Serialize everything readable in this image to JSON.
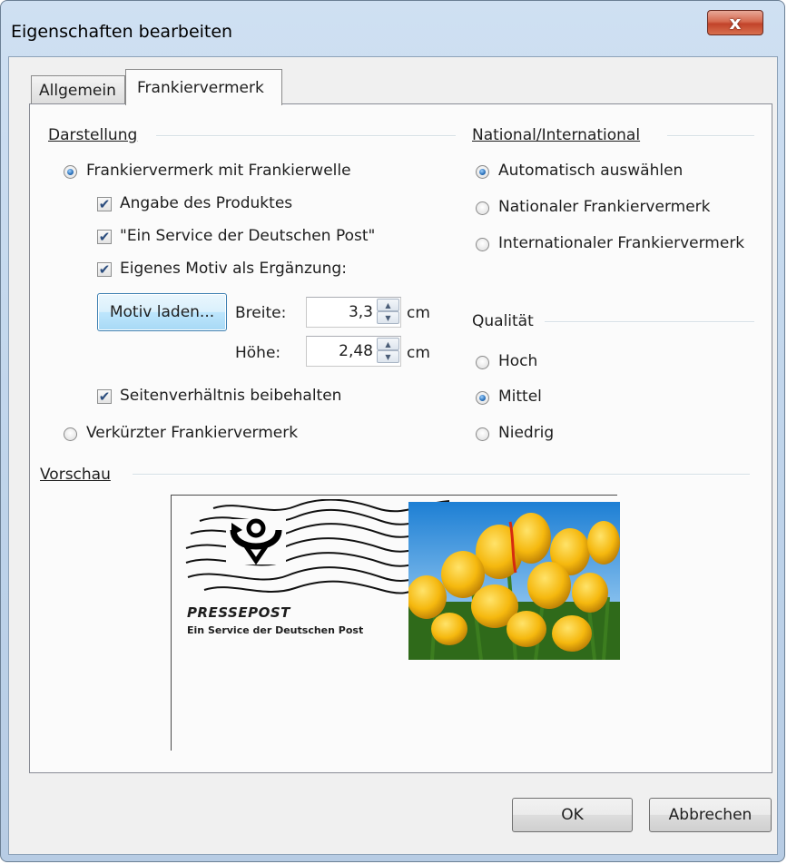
{
  "window": {
    "title": "Eigenschaften bearbeiten",
    "close_label": "x"
  },
  "tabs": [
    {
      "label": "Allgemein",
      "active": false
    },
    {
      "label": "Frankiervermerk",
      "active": true
    }
  ],
  "darstellung": {
    "label": "Darstellung",
    "option_wave": {
      "label": "Frankiervermerk mit Frankierwelle",
      "selected": true
    },
    "check_produkt": {
      "label": "Angabe des Produktes",
      "checked": true
    },
    "check_service": {
      "label": "\"Ein Service der Deutschen Post\"",
      "checked": true
    },
    "check_motiv": {
      "label": "Eigenes Motiv als Ergänzung:",
      "checked": true
    },
    "motiv_button": "Motiv laden...",
    "breite": {
      "label": "Breite:",
      "value": "3,3",
      "unit": "cm"
    },
    "hoehe": {
      "label": "Höhe:",
      "value": "2,48",
      "unit": "cm"
    },
    "check_ratio": {
      "label": "Seitenverhältnis beibehalten",
      "checked": true
    },
    "option_short": {
      "label": "Verkürzter Frankiervermerk",
      "selected": false
    }
  },
  "national": {
    "label": "National/International",
    "options": [
      {
        "label": "Automatisch auswählen",
        "selected": true
      },
      {
        "label": "Nationaler Frankiervermerk",
        "selected": false
      },
      {
        "label": "Internationaler Frankiervermerk",
        "selected": false
      }
    ]
  },
  "qualitaet": {
    "label": "Qualität",
    "options": [
      {
        "label": "Hoch",
        "selected": false
      },
      {
        "label": "Mittel",
        "selected": true
      },
      {
        "label": "Niedrig",
        "selected": false
      }
    ]
  },
  "vorschau": {
    "label": "Vorschau",
    "stamp_title": "PRESSEPOST",
    "stamp_subtitle": "Ein Service der Deutschen Post"
  },
  "buttons": {
    "ok": "OK",
    "cancel": "Abbrechen"
  },
  "icons": {
    "close": "close-icon",
    "check": "checkmark-icon",
    "spin_up": "arrow-up-icon",
    "spin_down": "arrow-down-icon",
    "posthorn": "posthorn-icon"
  },
  "colors": {
    "accent": "#2a6fb8",
    "close_red": "#c2432a",
    "check_blue": "#2b4d7e"
  }
}
